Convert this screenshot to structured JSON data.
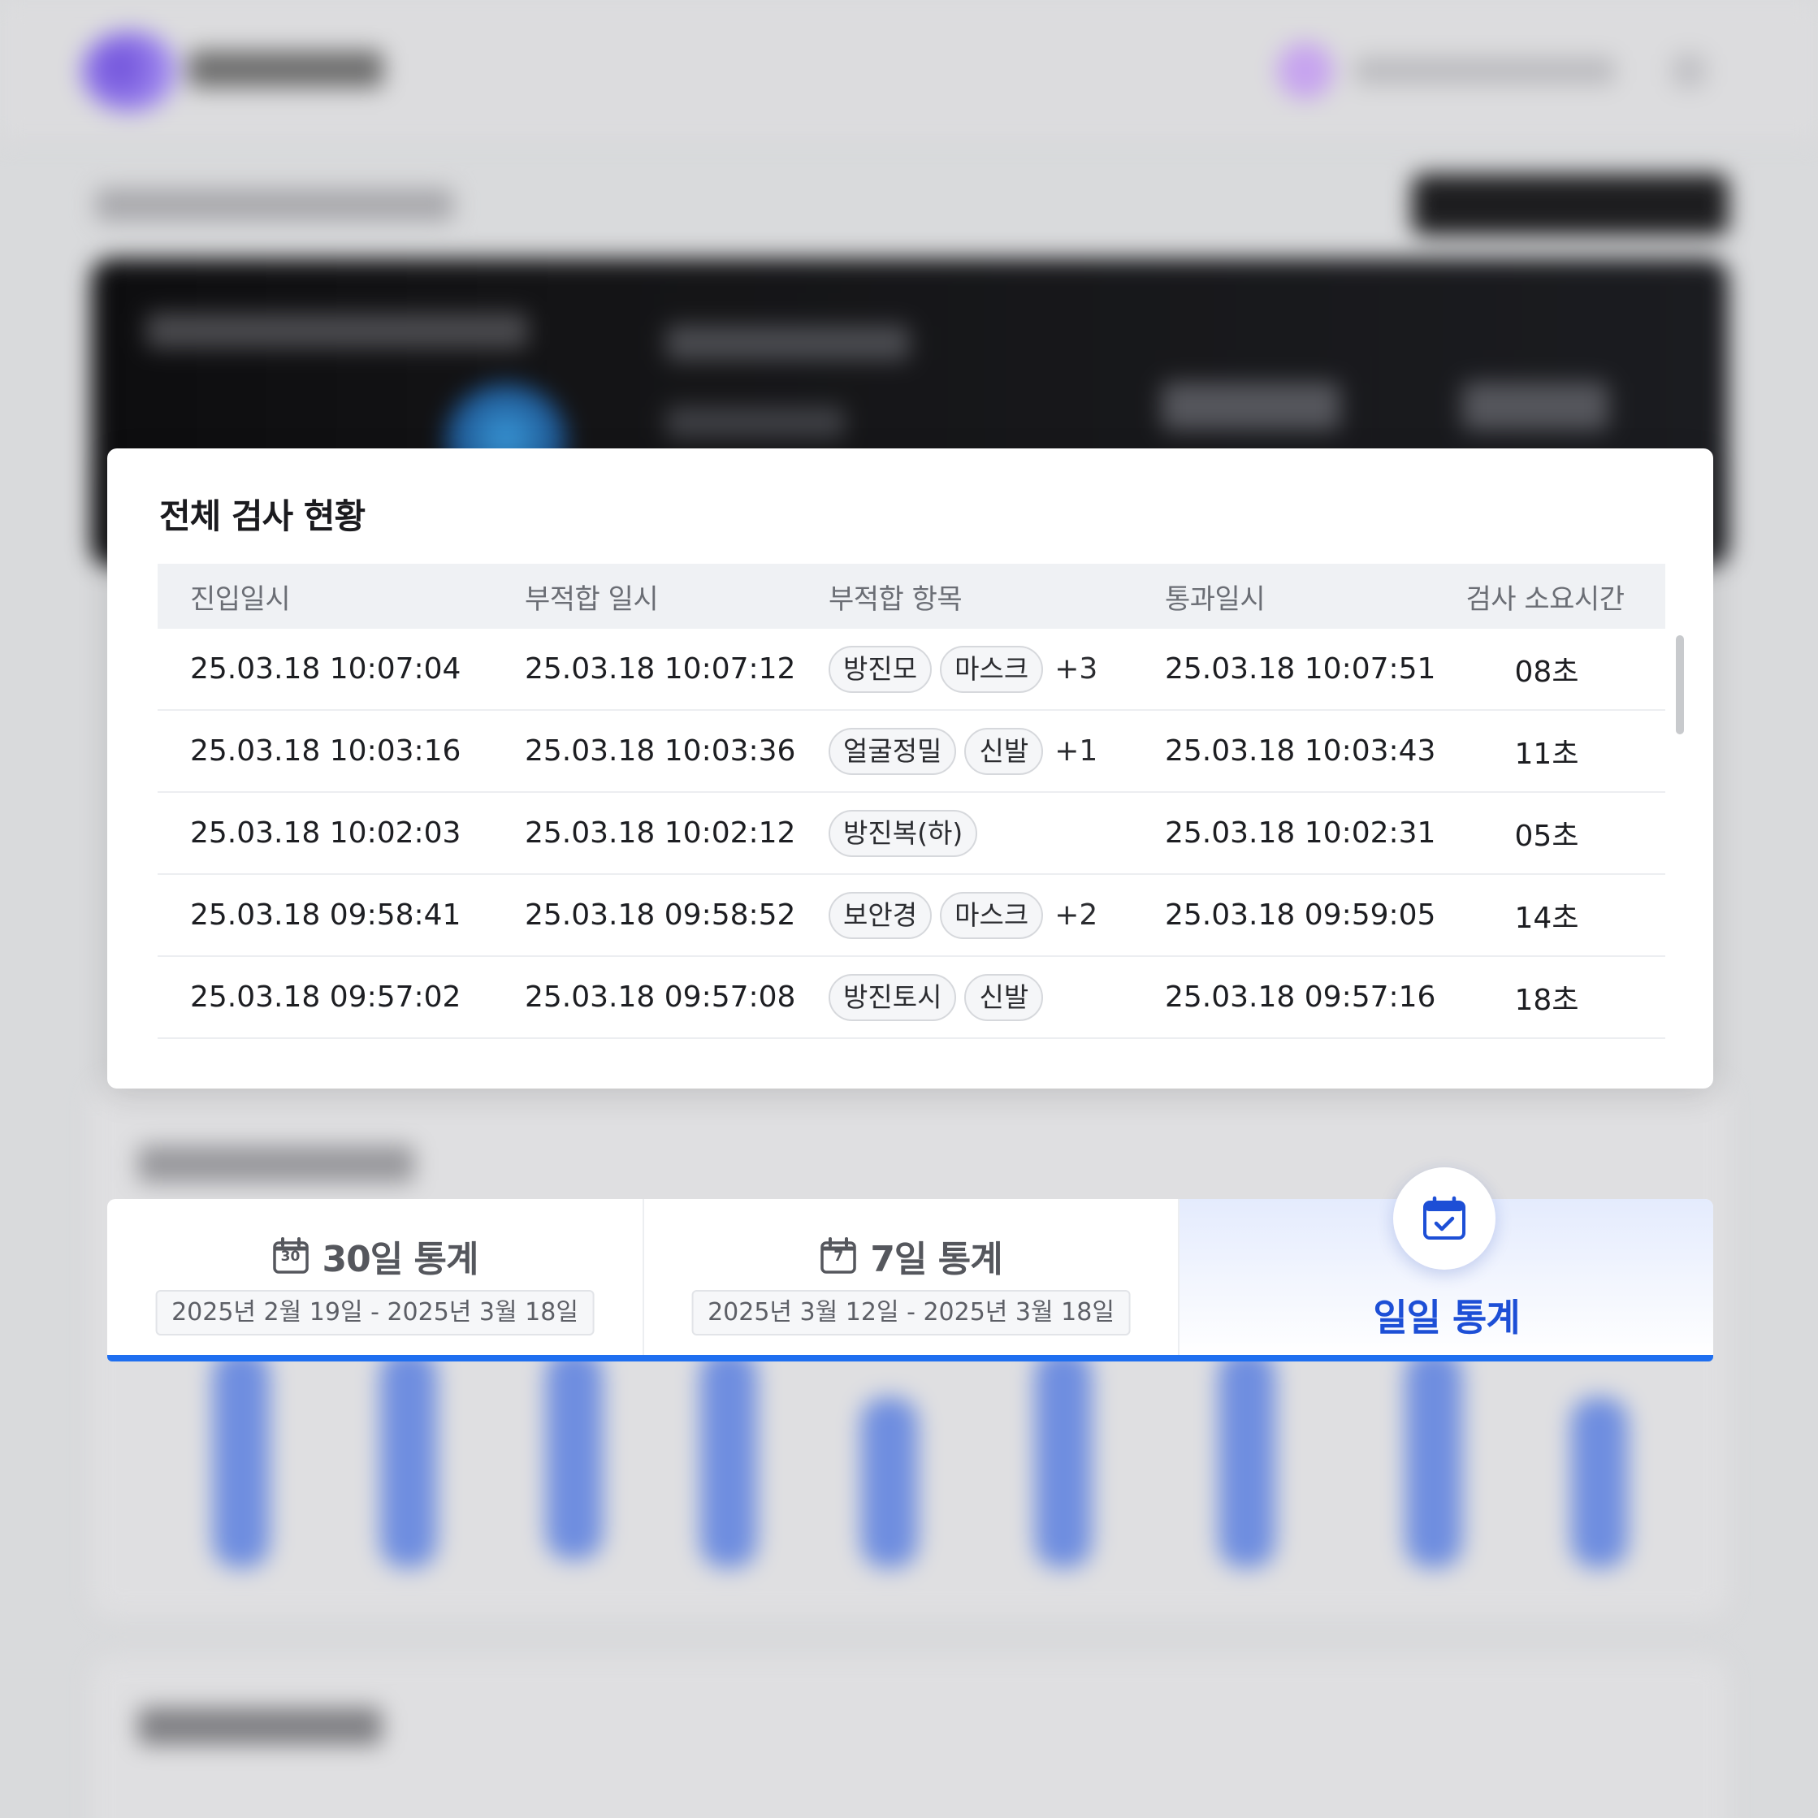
{
  "status_panel": {
    "title": "전체 검사 현황",
    "columns": [
      "진입일시",
      "부적합 일시",
      "부적합 항목",
      "통과일시",
      "검사 소요시간"
    ],
    "rows": [
      {
        "entry": "25.03.18  10:07:04",
        "fail_time": "25.03.18  10:07:12",
        "items": [
          "방진모",
          "마스크"
        ],
        "more": "+3",
        "pass": "25.03.18  10:07:51",
        "duration": "08초"
      },
      {
        "entry": "25.03.18  10:03:16",
        "fail_time": "25.03.18  10:03:36",
        "items": [
          "얼굴정밀",
          "신발"
        ],
        "more": "+1",
        "pass": "25.03.18  10:03:43",
        "duration": "11초"
      },
      {
        "entry": "25.03.18  10:02:03",
        "fail_time": "25.03.18  10:02:12",
        "items": [
          "방진복(하)"
        ],
        "more": "",
        "pass": "25.03.18  10:02:31",
        "duration": "05초"
      },
      {
        "entry": "25.03.18  09:58:41",
        "fail_time": "25.03.18  09:58:52",
        "items": [
          "보안경",
          "마스크"
        ],
        "more": "+2",
        "pass": "25.03.18  09:59:05",
        "duration": "14초"
      },
      {
        "entry": "25.03.18  09:57:02",
        "fail_time": "25.03.18  09:57:08",
        "items": [
          "방진토시",
          "신발"
        ],
        "more": "",
        "pass": "25.03.18  09:57:16",
        "duration": "18초"
      }
    ]
  },
  "stats_tabs": {
    "tab_30": {
      "label": "30일 통계",
      "icon_number": "30",
      "range": "2025년 2월 19일 - 2025년 3월 18일"
    },
    "tab_7": {
      "label": "7일 통계",
      "icon_number": "7",
      "range": "2025년 3월 12일 - 2025년 3월 18일"
    },
    "tab_daily": {
      "label": "일일 통계",
      "active": true
    }
  },
  "colors": {
    "accent_blue": "#1f6ff0",
    "active_text": "#1d4fd6",
    "bar_blue": "#6f8ee0"
  }
}
